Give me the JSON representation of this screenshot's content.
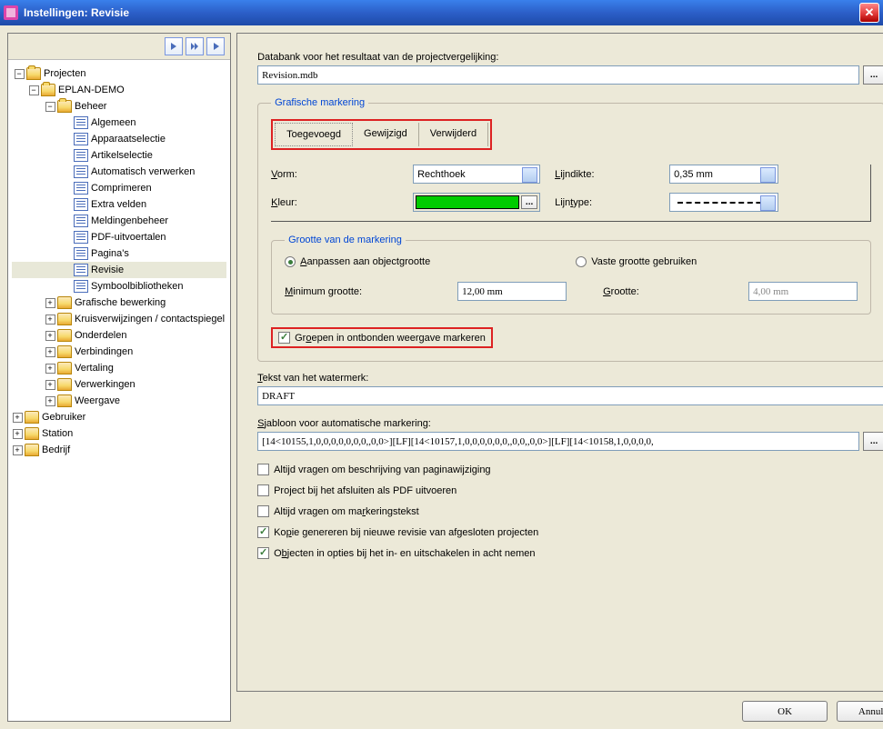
{
  "window": {
    "title": "Instellingen: Revisie"
  },
  "tree": {
    "root": "Projecten",
    "project": "EPLAN-DEMO",
    "beheer": "Beheer",
    "items_beheer": [
      "Algemeen",
      "Apparaatselectie",
      "Artikelselectie",
      "Automatisch verwerken",
      "Comprimeren",
      "Extra velden",
      "Meldingenbeheer",
      "PDF-uitvoertalen",
      "Pagina's",
      "Revisie",
      "Symboolbibliotheken"
    ],
    "items_rest": [
      "Grafische bewerking",
      "Kruisverwijzingen / contactspiegel",
      "Onderdelen",
      "Verbindingen",
      "Vertaling",
      "Verwerkingen",
      "Weergave"
    ],
    "top_other": [
      "Gebruiker",
      "Station",
      "Bedrijf"
    ]
  },
  "main": {
    "db_label": "Databank voor het resultaat van de projectvergelijking:",
    "db_value": "Revision.mdb",
    "gm_legend": "Grafische markering",
    "tabs": {
      "added": "Toegevoegd",
      "changed": "Gewijzigd",
      "deleted": "Verwijderd"
    },
    "vorm_label": "Vorm:",
    "vorm_value": "Rechthoek",
    "kleur_label": "Kleur:",
    "lijndikte_label": "Lijndikte:",
    "lijndikte_value": "0,35 mm",
    "lijntype_label": "Lijntype:",
    "grootte_legend": "Grootte van de markering",
    "radio1": "Aanpassen aan objectgrootte",
    "radio2": "Vaste grootte gebruiken",
    "min_label": "Minimum grootte:",
    "min_value": "12,00 mm",
    "grootte_label": "Grootte:",
    "grootte_value": "4,00 mm",
    "groepen_label": "Groepen in ontbonden weergave markeren",
    "wm_label": "Tekst van het watermerk:",
    "wm_value": "DRAFT",
    "sjabloon_label": "Sjabloon voor automatische markering:",
    "sjabloon_value": "[14<10155,1,0,0,0,0,0,0,0,,0,0>][LF][14<10157,1,0,0,0,0,0,0,,0,0,,0,0>][LF][14<10158,1,0,0,0,0,",
    "cb1": "Altijd vragen om beschrijving van paginawijziging",
    "cb2": "Project bij het afsluiten als PDF uitvoeren",
    "cb3": "Altijd vragen om markeringstekst",
    "cb4": "Kopie genereren bij nieuwe revisie van afgesloten projecten",
    "cb5": "Objecten in opties bij het in- en uitschakelen in acht nemen"
  },
  "buttons": {
    "ok": "OK",
    "cancel": "Annuleren"
  }
}
